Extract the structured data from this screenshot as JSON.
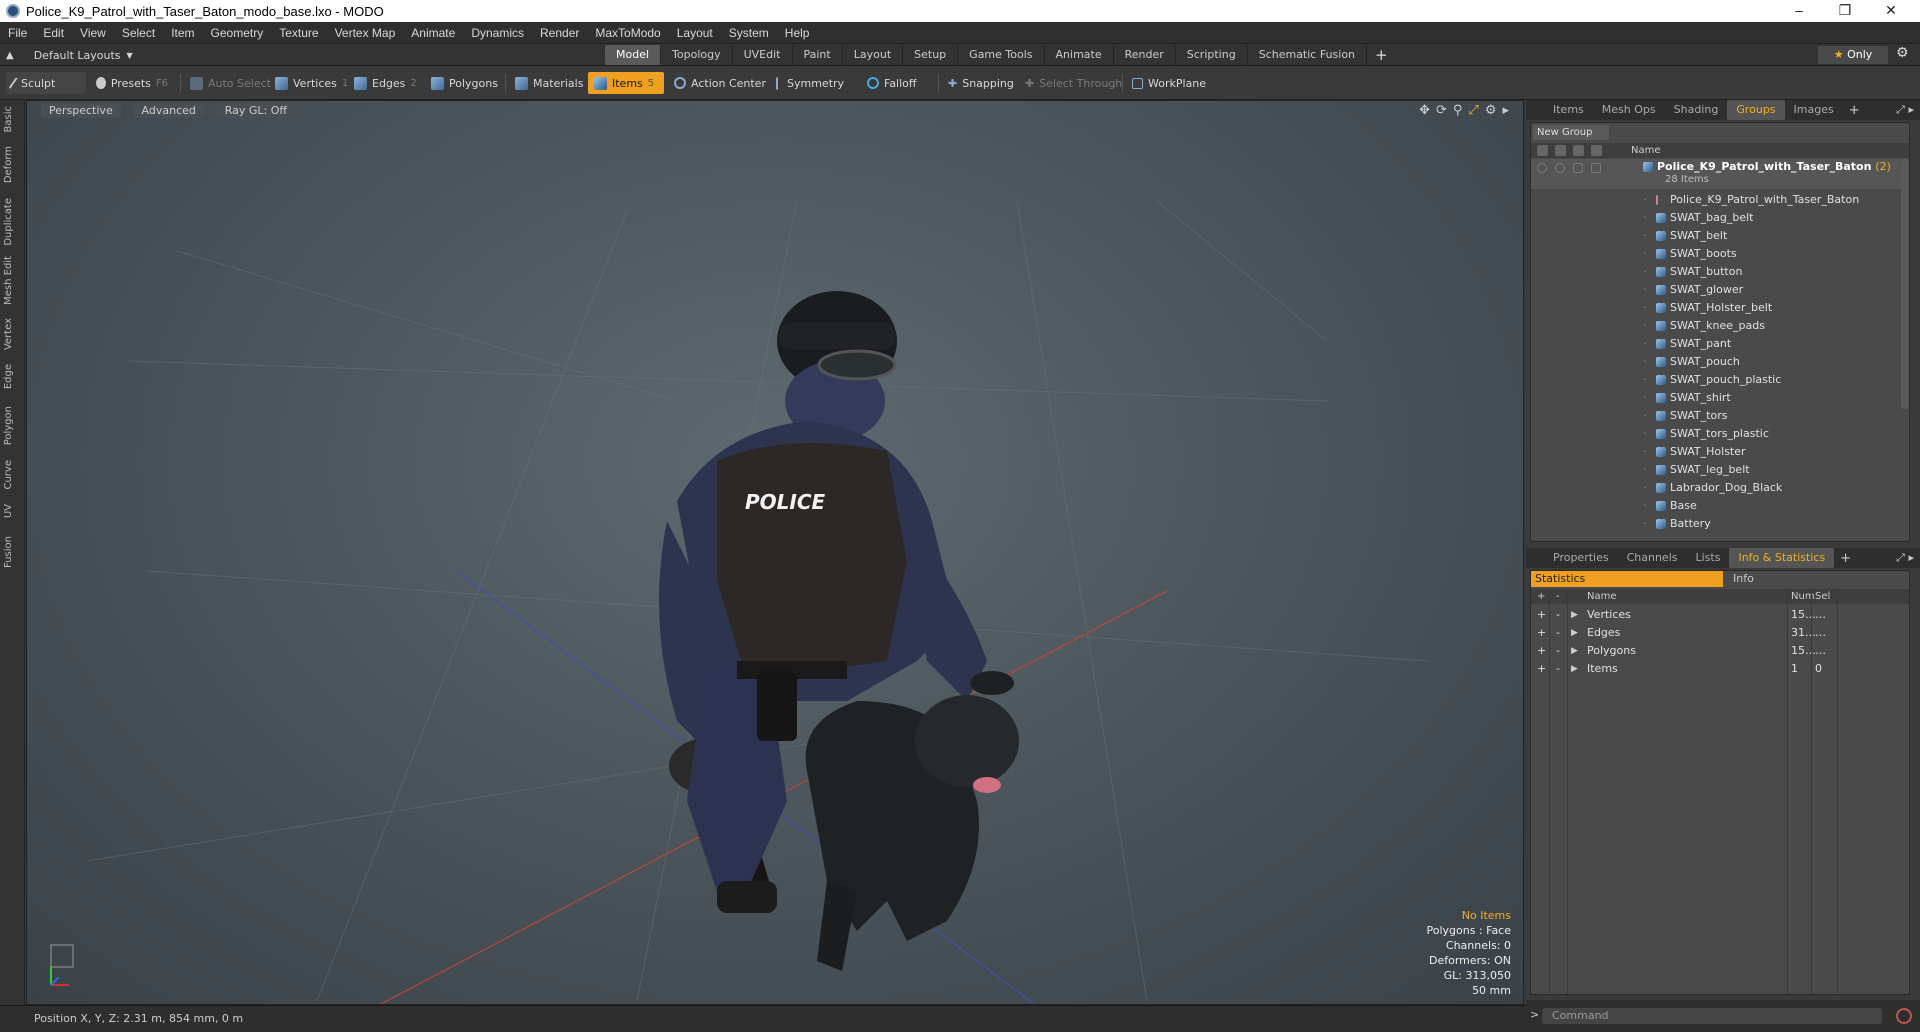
{
  "window": {
    "title": "Police_K9_Patrol_with_Taser_Baton_modo_base.lxo - MODO"
  },
  "menu": [
    "File",
    "Edit",
    "View",
    "Select",
    "Item",
    "Geometry",
    "Texture",
    "Vertex Map",
    "Animate",
    "Dynamics",
    "Render",
    "MaxToModo",
    "Layout",
    "System",
    "Help"
  ],
  "layoutbar": {
    "layout_label": "Default Layouts",
    "tabs": [
      "Model",
      "Topology",
      "UVEdit",
      "Paint",
      "Layout",
      "Setup",
      "Game Tools",
      "Animate",
      "Render",
      "Scripting",
      "Schematic Fusion"
    ],
    "active_tab": "Model",
    "only_label": "Only"
  },
  "toolbar": {
    "sculpt": "Sculpt",
    "presets": "Presets",
    "presets_key": "F6",
    "auto_select": "Auto Select",
    "vertices": "Vertices",
    "vertices_key": "1",
    "edges": "Edges",
    "edges_key": "2",
    "polygons": "Polygons",
    "materials": "Materials",
    "items": "Items",
    "items_key": "5",
    "action_center": "Action Center",
    "symmetry": "Symmetry",
    "falloff": "Falloff",
    "snapping": "Snapping",
    "select_through": "Select Through",
    "workplane": "WorkPlane"
  },
  "left_tabs": [
    "Basic",
    "Deform",
    "Duplicate",
    "Mesh Edit",
    "Vertex",
    "Edge",
    "Polygon",
    "Curve",
    "UV",
    "Fusion"
  ],
  "viewport": {
    "view_mode": "Perspective",
    "shading": "Advanced",
    "raygl": "Ray GL: Off",
    "vest_text": "POLICE",
    "hud": {
      "items": "No Items",
      "polygons": "Polygons : Face",
      "channels": "Channels: 0",
      "deformers": "Deformers: ON",
      "gl": "GL: 313,050",
      "lens": "50 mm"
    }
  },
  "status": {
    "position": "Position X, Y, Z:   2.31 m, 854 mm, 0 m"
  },
  "top_panel": {
    "tabs": [
      "Items",
      "Mesh Ops",
      "Shading",
      "Groups",
      "Images"
    ],
    "active_tab": "Groups",
    "new_group": "New Group",
    "name_header": "Name",
    "root": {
      "name": "Police_K9_Patrol_with_Taser_Baton",
      "count": "(2)",
      "sub": "28 Items"
    },
    "items": [
      "Police_K9_Patrol_with_Taser_Baton",
      "SWAT_bag_belt",
      "SWAT_belt",
      "SWAT_boots",
      "SWAT_button",
      "SWAT_glower",
      "SWAT_Holster_belt",
      "SWAT_knee_pads",
      "SWAT_pant",
      "SWAT_pouch",
      "SWAT_pouch_plastic",
      "SWAT_shirt",
      "SWAT_tors",
      "SWAT_tors_plastic",
      "SWAT_Holster",
      "SWAT_leg_belt",
      "Labrador_Dog_Black",
      "Base",
      "Battery"
    ]
  },
  "bottom_panel": {
    "tabs": [
      "Properties",
      "Channels",
      "Lists",
      "Info & Statistics"
    ],
    "active_tab": "Info & Statistics",
    "sub_tabs": {
      "statistics": "Statistics",
      "info": "Info"
    },
    "headers": {
      "name": "Name",
      "num": "Num",
      "sel": "Sel"
    },
    "rows": [
      {
        "name": "Vertices",
        "num": "15…",
        "sel": "…"
      },
      {
        "name": "Edges",
        "num": "31…",
        "sel": "…"
      },
      {
        "name": "Polygons",
        "num": "15…",
        "sel": "…"
      },
      {
        "name": "Items",
        "num": "1",
        "sel": "0"
      }
    ]
  },
  "command": {
    "placeholder": "Command"
  },
  "colors": {
    "accent": "#f0a020",
    "panel": "#3a3a3a",
    "viewport": "#4c565c"
  }
}
